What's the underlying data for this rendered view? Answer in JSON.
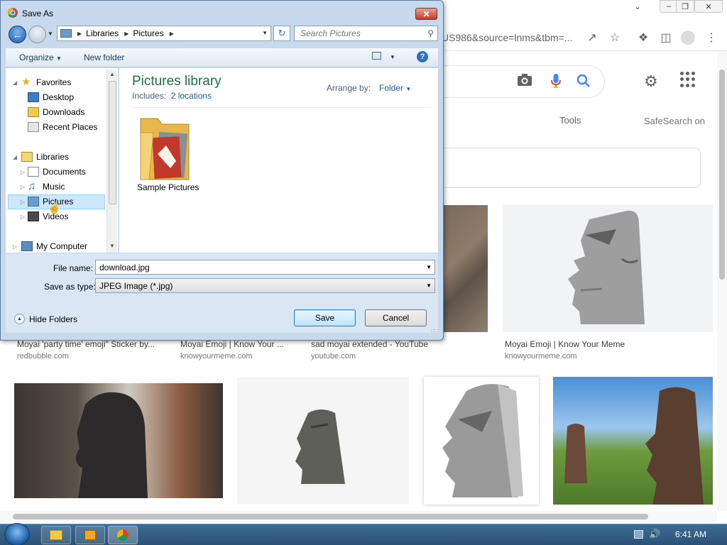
{
  "dialog": {
    "title": "Save As",
    "address_segments": [
      "Libraries",
      "Pictures"
    ],
    "search_placeholder": "Search Pictures",
    "toolbar": {
      "organize": "Organize",
      "new_folder": "New folder"
    },
    "nav_tree": {
      "favorites": "Favorites",
      "desktop": "Desktop",
      "downloads": "Downloads",
      "recent_places": "Recent Places",
      "libraries": "Libraries",
      "documents": "Documents",
      "music": "Music",
      "pictures": "Pictures",
      "videos": "Videos",
      "my_computer": "My Computer"
    },
    "library_title": "Pictures library",
    "includes_label": "Includes:",
    "includes_link": "2 locations",
    "arrange_by_label": "Arrange by:",
    "arrange_by_value": "Folder",
    "items": [
      {
        "name": "Sample Pictures"
      }
    ],
    "file_name_label": "File name:",
    "file_name_value": "download.jpg",
    "save_type_label": "Save as type:",
    "save_type_value": "JPEG Image (*.jpg)",
    "hide_folders": "Hide Folders",
    "save_button": "Save",
    "cancel_button": "Cancel"
  },
  "browser": {
    "url_fragment": "US986&source=lnms&tbm=...",
    "tools": "Tools",
    "safesearch": "SafeSearch on",
    "results_row1": [
      {
        "title": "Moyai 'party time' emoji\" Sticker by...",
        "source": "redbubble.com"
      },
      {
        "title": "Moyai Emoji | Know Your ...",
        "source": "knowyourmeme.com"
      },
      {
        "title": "sad moyai extended - YouTube",
        "source": "youtube.com"
      },
      {
        "title": "Moyai Emoji | Know Your Meme",
        "source": "knowyourmeme.com"
      }
    ]
  },
  "taskbar": {
    "clock": "6:41 AM"
  },
  "icons": {
    "favorites": "star-icon",
    "desktop": "desktop-icon",
    "downloads": "downloads-folder-icon",
    "recent": "recent-places-icon",
    "libraries": "libraries-icon",
    "documents": "documents-icon",
    "music": "music-icon",
    "pictures": "pictures-icon",
    "videos": "videos-icon",
    "computer": "computer-icon"
  },
  "colors": {
    "library_title": "#1e7145",
    "link": "#1b5fad",
    "selection": "#cce8ff",
    "dialog_frame": "#c7d9ec"
  }
}
